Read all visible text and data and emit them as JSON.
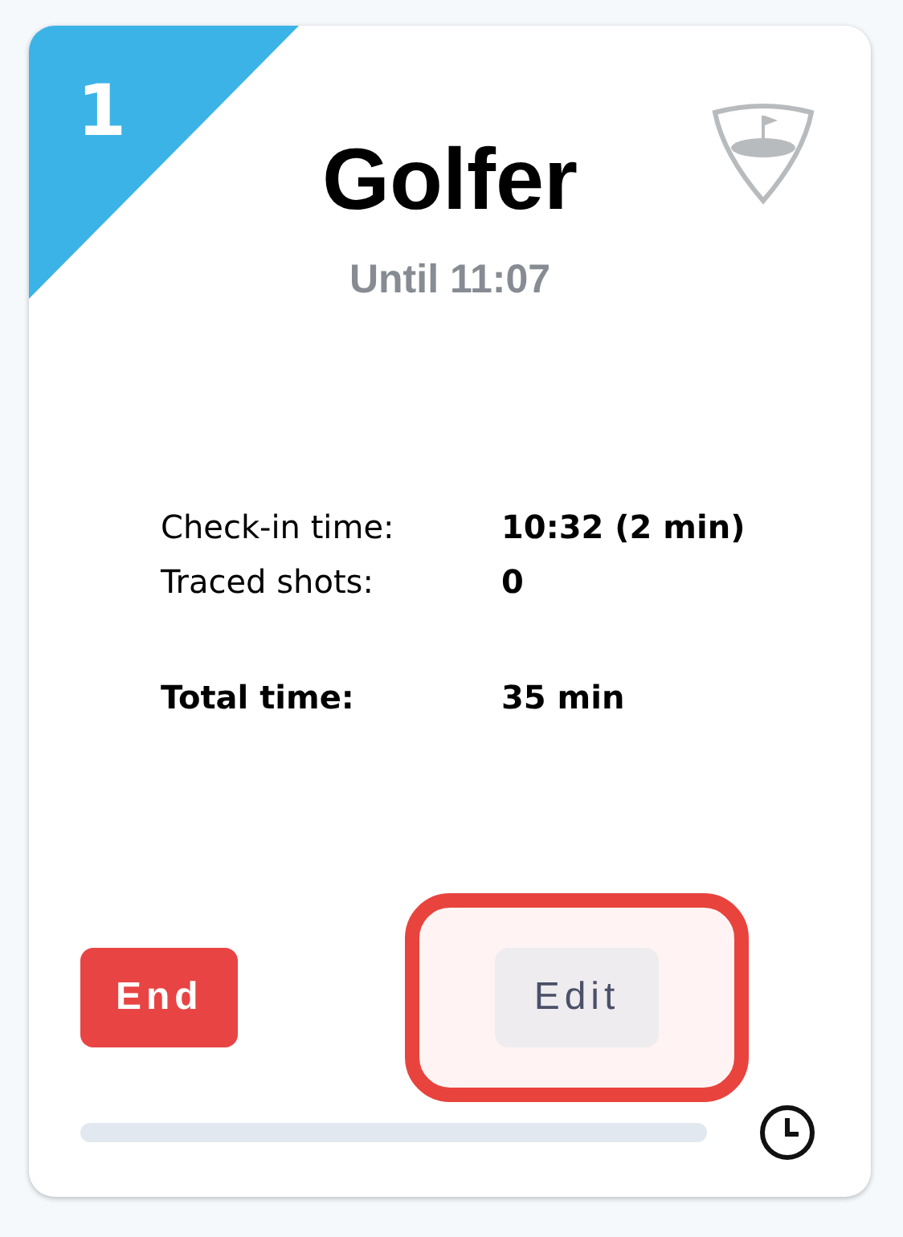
{
  "card": {
    "number": "1",
    "title": "Golfer",
    "subtitle": "Until 11:07",
    "details": [
      {
        "label": "Check-in time:",
        "value": "10:32 (2 min)",
        "kind": "plain"
      },
      {
        "label": "Traced shots:",
        "value": "0",
        "kind": "plain"
      },
      {
        "label": "Total time:",
        "value": "35 min",
        "kind": "total"
      }
    ],
    "buttons": [
      {
        "label": "End",
        "kind": "danger",
        "highlighted": false
      },
      {
        "label": "Edit",
        "kind": "secondary",
        "highlighted": true
      }
    ],
    "progress": {
      "level": 0
    }
  }
}
